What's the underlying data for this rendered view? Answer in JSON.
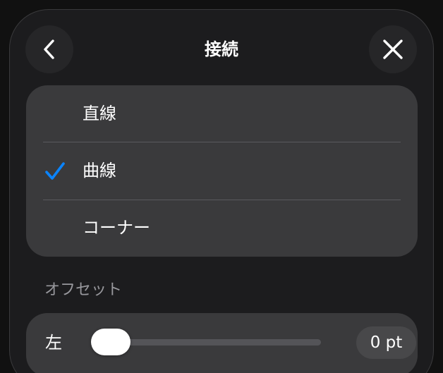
{
  "header": {
    "title": "接続",
    "back_icon": "chevron-left-icon",
    "close_icon": "close-icon"
  },
  "options": [
    {
      "label": "直線",
      "selected": false
    },
    {
      "label": "曲線",
      "selected": true
    },
    {
      "label": "コーナー",
      "selected": false
    }
  ],
  "offset": {
    "section_title": "オフセット",
    "slider_label": "左",
    "value_text": "0 pt",
    "level": 0
  },
  "colors": {
    "accent": "#0a84ff",
    "panel": "#1c1c1e",
    "card": "#3a3a3c"
  }
}
